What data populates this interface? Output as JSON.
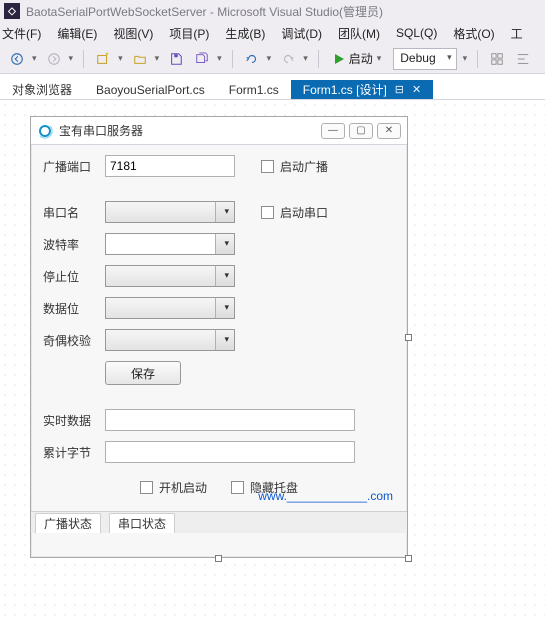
{
  "vs": {
    "title": "BaotaSerialPortWebSocketServer - Microsoft Visual Studio(管理员)",
    "menu": {
      "file": "文件(F)",
      "edit": "编辑(E)",
      "view": "视图(V)",
      "project": "项目(P)",
      "build": "生成(B)",
      "debug": "调试(D)",
      "team": "团队(M)",
      "sql": "SQL(Q)",
      "format": "格式(O)",
      "tools": "工"
    },
    "toolbar": {
      "start_label": "启动",
      "config": "Debug"
    },
    "tabs": {
      "t0": "对象浏览器",
      "t1": "BaoyouSerialPort.cs",
      "t2": "Form1.cs",
      "t3": "Form1.cs [设计]"
    }
  },
  "form": {
    "title": "宝有串口服务器",
    "labels": {
      "port": "广播端口",
      "serial_name": "串口名",
      "baud": "波特率",
      "stop": "停止位",
      "data": "数据位",
      "parity": "奇偶校验",
      "realtime": "实时数据",
      "bytes": "累计字节"
    },
    "values": {
      "port": "7181",
      "serial_name": "",
      "baud": "",
      "stop": "",
      "data": "",
      "parity": "",
      "realtime": "",
      "bytes": ""
    },
    "checks": {
      "start_broadcast": "启动广播",
      "start_serial": "启动串口",
      "boot_start": "开机启动",
      "hide_tray": "隐藏托盘"
    },
    "buttons": {
      "save": "保存"
    },
    "link": "www.____________.com",
    "tabs": {
      "broadcast_status": "广播状态",
      "serial_status": "串口状态"
    }
  }
}
